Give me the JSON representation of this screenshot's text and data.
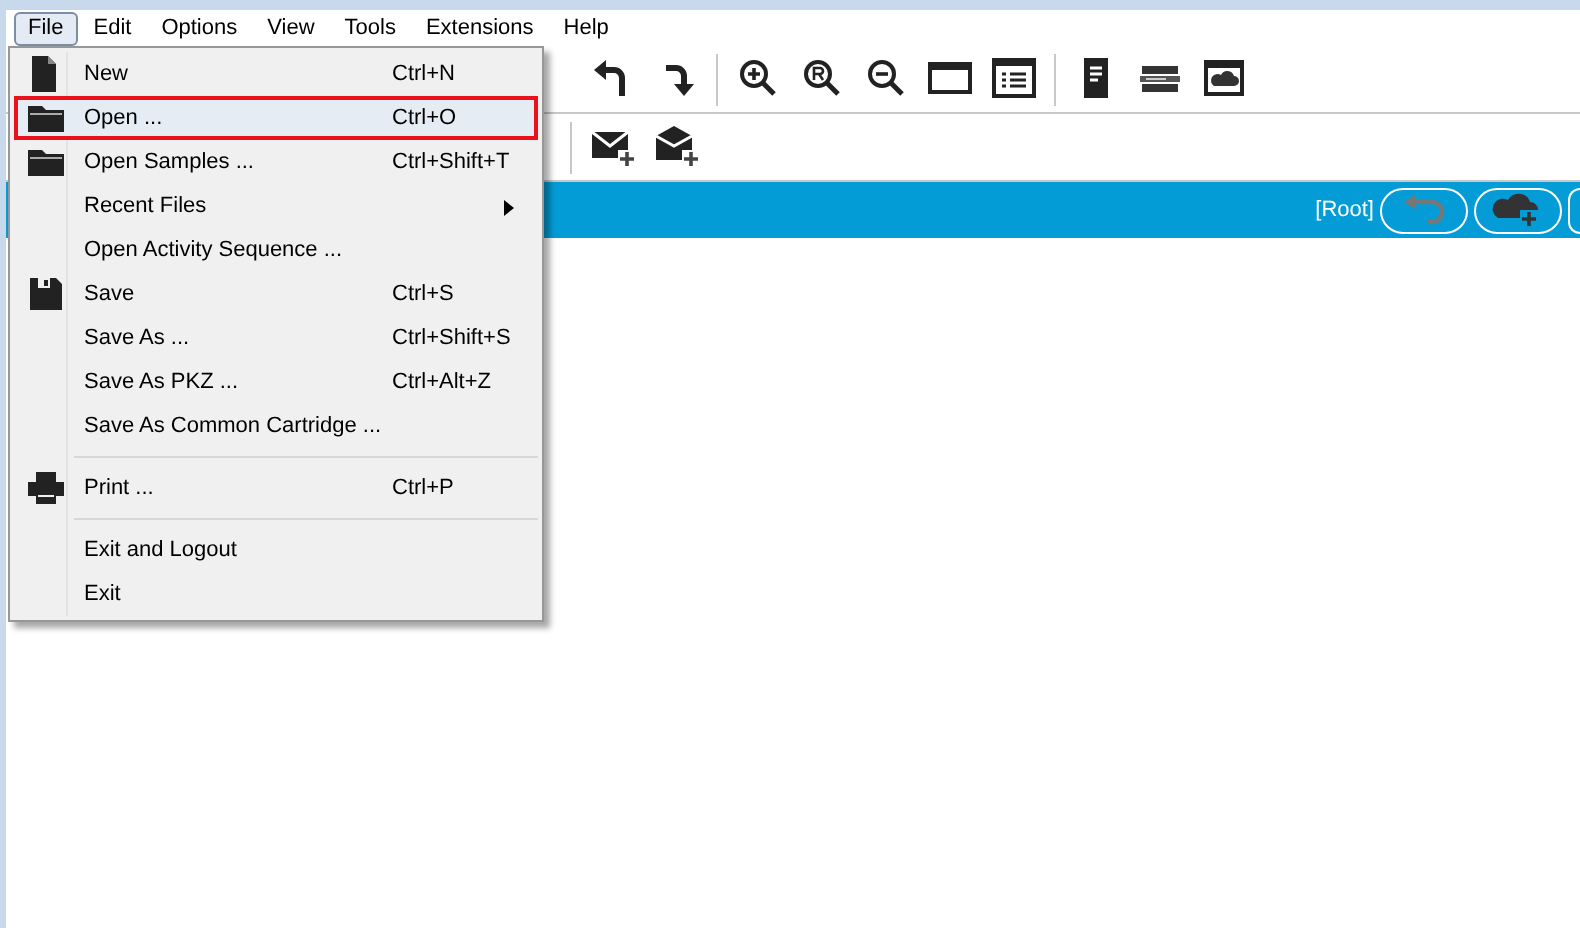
{
  "menubar": [
    {
      "label": "File",
      "selected": true
    },
    {
      "label": "Edit",
      "selected": false
    },
    {
      "label": "Options",
      "selected": false
    },
    {
      "label": "View",
      "selected": false
    },
    {
      "label": "Tools",
      "selected": false
    },
    {
      "label": "Extensions",
      "selected": false
    },
    {
      "label": "Help",
      "selected": false
    }
  ],
  "file_menu": [
    {
      "label": "New",
      "shortcut": "Ctrl+N",
      "kind": "document",
      "selected": false
    },
    {
      "label": "Open ...",
      "shortcut": "Ctrl+O",
      "kind": "folder",
      "selected": true
    },
    {
      "label": "Open Samples ...",
      "shortcut": "Ctrl+Shift+T",
      "kind": "folder",
      "selected": false
    },
    {
      "label": "Recent Files",
      "kind": "submenu",
      "selected": false
    },
    {
      "label": "Open Activity Sequence ...",
      "kind": "text",
      "selected": false
    },
    {
      "label": "Save",
      "shortcut": "Ctrl+S",
      "kind": "floppy",
      "selected": false
    },
    {
      "label": "Save As ...",
      "shortcut": "Ctrl+Shift+S",
      "kind": "text",
      "selected": false
    },
    {
      "label": "Save As PKZ ...",
      "shortcut": "Ctrl+Alt+Z",
      "kind": "text",
      "selected": false
    },
    {
      "label": "Save As Common Cartridge ...",
      "kind": "text",
      "selected": false
    },
    {
      "kind": "separator"
    },
    {
      "label": "Print ...",
      "shortcut": "Ctrl+P",
      "kind": "printer",
      "selected": false
    },
    {
      "kind": "separator"
    },
    {
      "label": "Exit and Logout",
      "kind": "text",
      "selected": false
    },
    {
      "label": "Exit",
      "kind": "text",
      "selected": false
    }
  ],
  "breadcrumb": "[Root]"
}
